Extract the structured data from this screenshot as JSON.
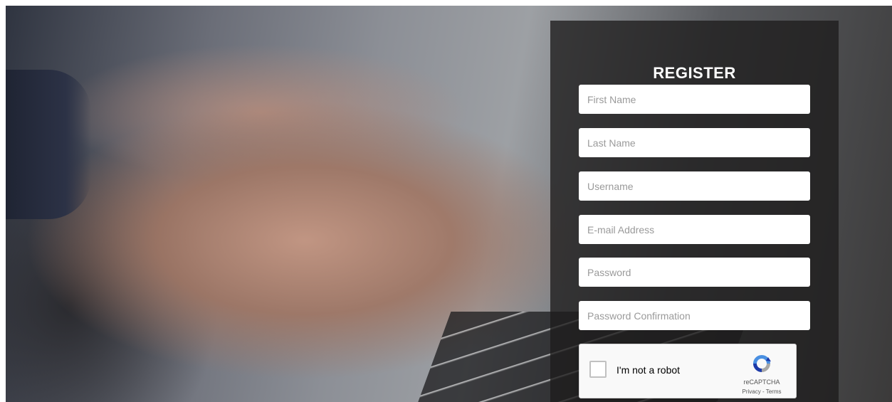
{
  "form": {
    "title": "REGISTER",
    "fields": {
      "first_name": {
        "placeholder": "First Name",
        "value": ""
      },
      "last_name": {
        "placeholder": "Last Name",
        "value": ""
      },
      "username": {
        "placeholder": "Username",
        "value": ""
      },
      "email": {
        "placeholder": "E-mail Address",
        "value": ""
      },
      "password": {
        "placeholder": "Password",
        "value": ""
      },
      "password_confirmation": {
        "placeholder": "Password Confirmation",
        "value": ""
      }
    }
  },
  "recaptcha": {
    "label": "I'm not a robot",
    "brand": "reCAPTCHA",
    "privacy": "Privacy",
    "separator": " - ",
    "terms": "Terms",
    "checked": false,
    "icon": "recaptcha-logo-icon"
  },
  "colors": {
    "panel_background": "#1e1c1c",
    "title_text": "#ffffff",
    "recaptcha_blue": "#4a90e2",
    "recaptcha_gray": "#a6a6a6"
  }
}
